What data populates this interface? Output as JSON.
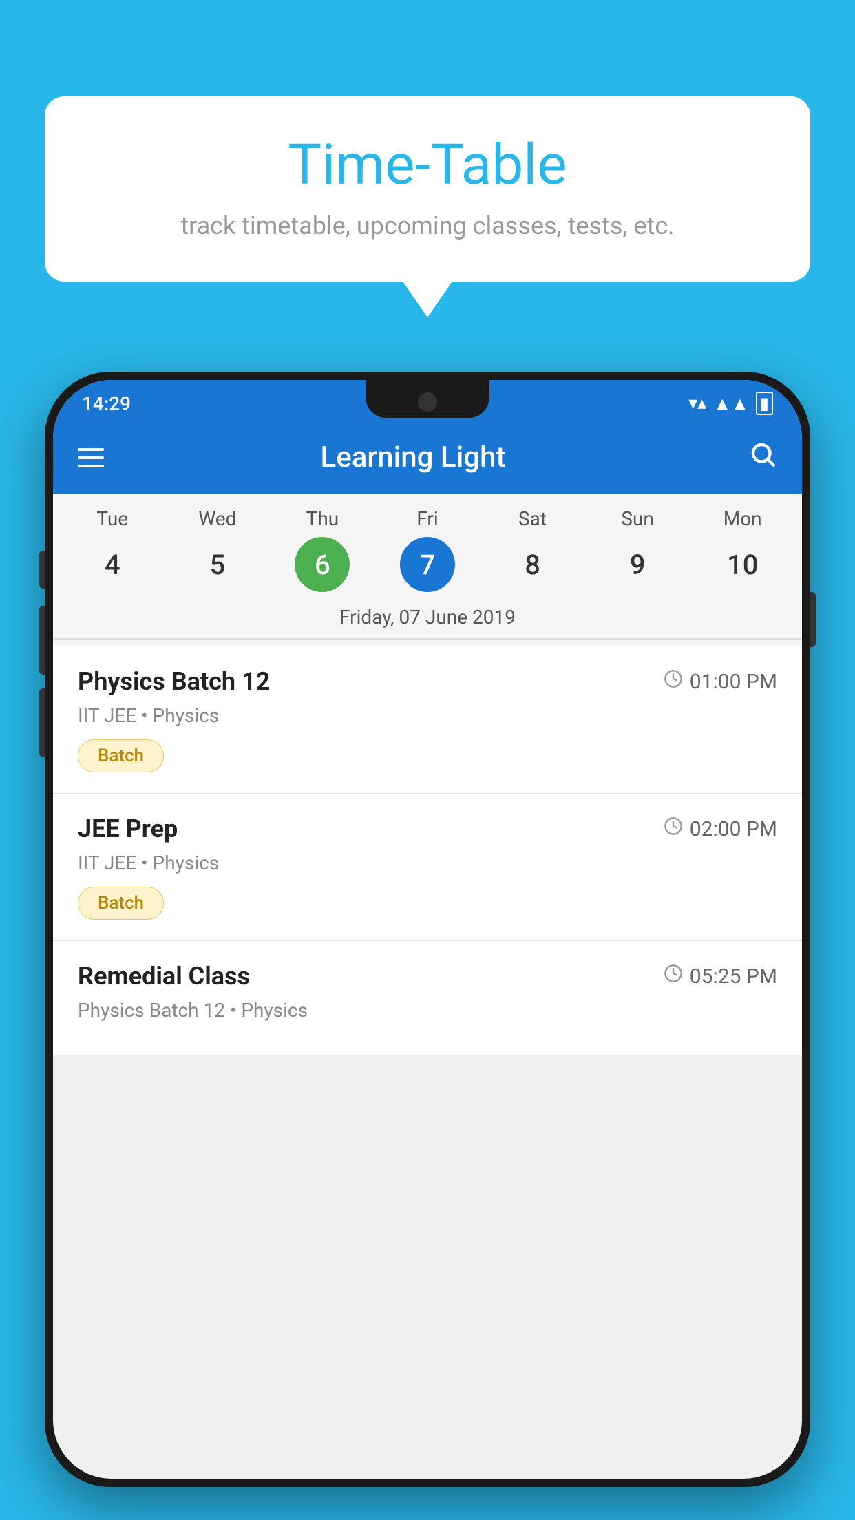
{
  "background_color": "#29b6e8",
  "bubble": {
    "title": "Time-Table",
    "subtitle": "track timetable, upcoming classes, tests, etc."
  },
  "app": {
    "status_time": "14:29",
    "title": "Learning Light",
    "search_label": "Search"
  },
  "calendar": {
    "days": [
      "Tue",
      "Wed",
      "Thu",
      "Fri",
      "Sat",
      "Sun",
      "Mon"
    ],
    "dates": [
      "4",
      "5",
      "6",
      "7",
      "8",
      "9",
      "10"
    ],
    "today_index": 2,
    "selected_index": 3,
    "selected_date_label": "Friday, 07 June 2019"
  },
  "schedule": [
    {
      "title": "Physics Batch 12",
      "time": "01:00 PM",
      "subtitle": "IIT JEE • Physics",
      "badge": "Batch"
    },
    {
      "title": "JEE Prep",
      "time": "02:00 PM",
      "subtitle": "IIT JEE • Physics",
      "badge": "Batch"
    },
    {
      "title": "Remedial Class",
      "time": "05:25 PM",
      "subtitle": "Physics Batch 12 • Physics",
      "badge": ""
    }
  ]
}
